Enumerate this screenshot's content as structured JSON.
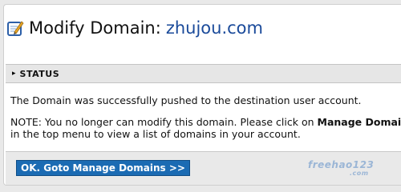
{
  "header": {
    "title": "Modify Domain:",
    "domain": "zhujou.com",
    "icon": "edit-note-icon"
  },
  "status": {
    "arrow": "▸",
    "label": "STATUS"
  },
  "messages": {
    "success": "The Domain was successfully pushed to the destination user account.",
    "note_prefix": "NOTE: You no longer can modify this domain. Please click on ",
    "note_bold": "Manage Domain",
    "note_line2": "in the top menu to view a list of domains in your account."
  },
  "footer": {
    "ok_button_label": "OK. Goto Manage Domains >>"
  },
  "watermark": {
    "text": "freehao123",
    "suffix": ".com"
  },
  "colors": {
    "button_bg": "#1b6bb3",
    "domain_text": "#1a4a9a",
    "status_bg": "#e6e6e6"
  }
}
